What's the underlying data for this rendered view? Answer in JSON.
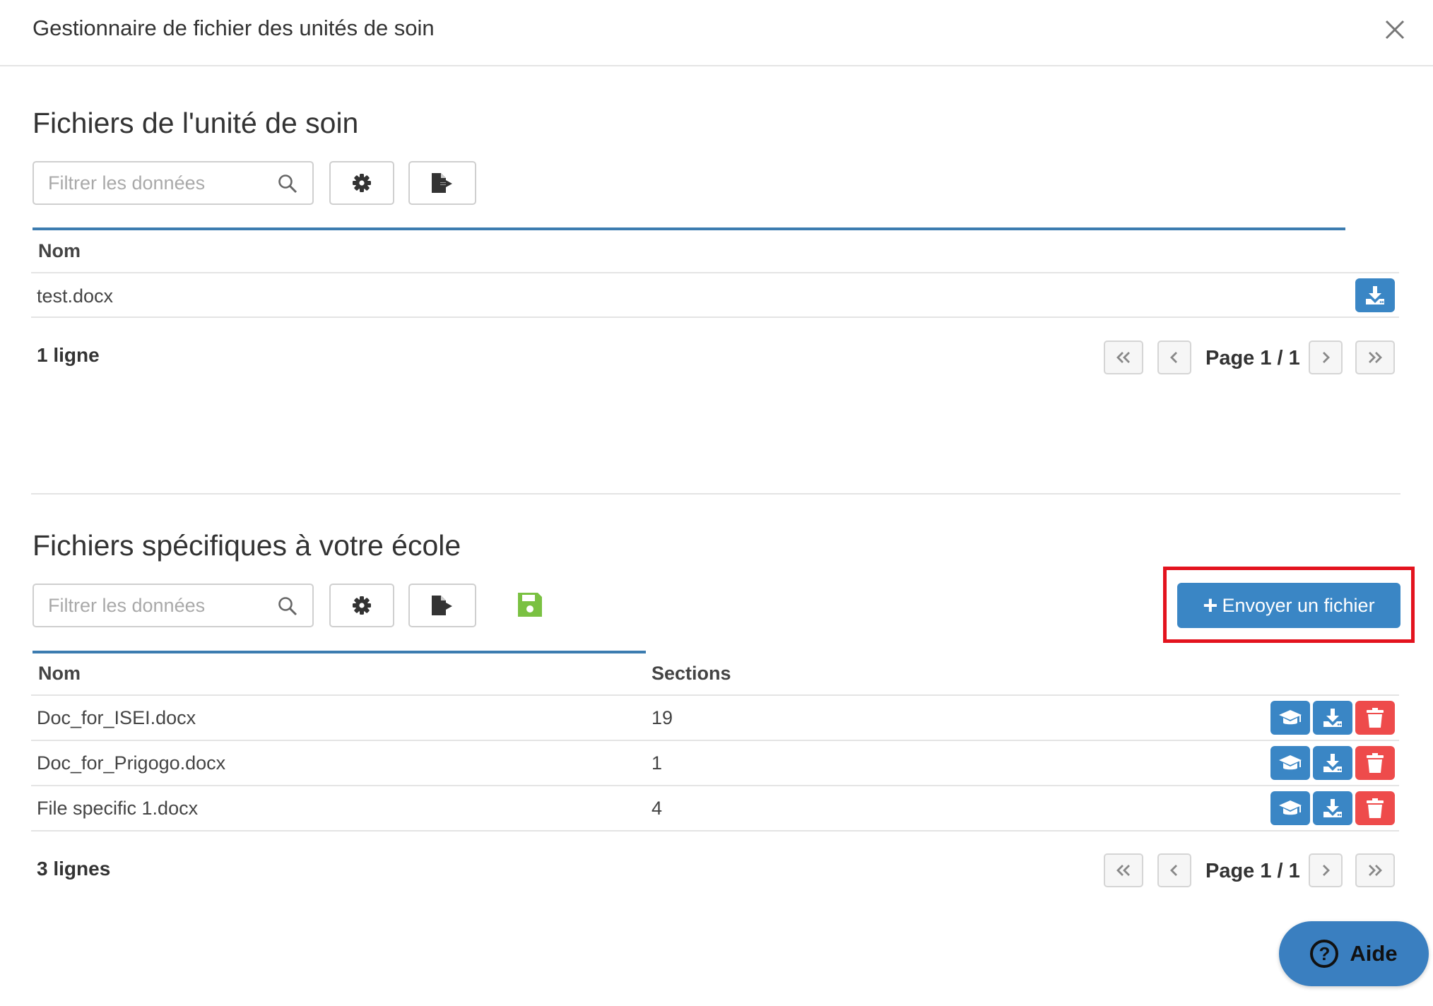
{
  "header": {
    "title": "Gestionnaire de fichier des unités de soin"
  },
  "section1": {
    "title": "Fichiers de l'unité de soin",
    "filter_placeholder": "Filtrer les données",
    "columns": [
      "Nom"
    ],
    "rows": [
      {
        "name": "test.docx"
      }
    ],
    "count_label": "1 ligne",
    "page_label": "Page 1 / 1"
  },
  "section2": {
    "title": "Fichiers spécifiques à votre école",
    "filter_placeholder": "Filtrer les données",
    "upload_label": "Envoyer un fichier",
    "columns": [
      "Nom",
      "Sections"
    ],
    "rows": [
      {
        "name": "Doc_for_ISEI.docx",
        "sections": "19"
      },
      {
        "name": "Doc_for_Prigogo.docx",
        "sections": "1"
      },
      {
        "name": "File specific 1.docx",
        "sections": "4"
      }
    ],
    "count_label": "3 lignes",
    "page_label": "Page 1 / 1"
  },
  "help": {
    "label": "Aide"
  },
  "colors": {
    "accent": "#3a86c5",
    "danger": "#ee4b4b",
    "save": "#7ac142",
    "highlight": "#e3131e"
  },
  "icons": [
    "close-icon",
    "search-icon",
    "gear-icon",
    "export-icon",
    "download-icon",
    "graduation-cap-icon",
    "trash-icon",
    "save-icon",
    "plus-icon",
    "help-icon"
  ]
}
